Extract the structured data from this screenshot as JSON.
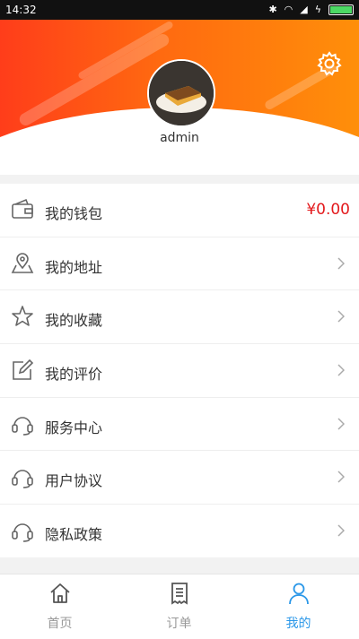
{
  "status_bar": {
    "time": "14:32"
  },
  "profile": {
    "username": "admin"
  },
  "menu": {
    "items": [
      {
        "label": "我的钱包",
        "value": "¥0.00",
        "icon": "wallet-icon"
      },
      {
        "label": "我的地址",
        "icon": "location-icon"
      },
      {
        "label": "我的收藏",
        "icon": "star-icon"
      },
      {
        "label": "我的评价",
        "icon": "edit-icon"
      },
      {
        "label": "服务中心",
        "icon": "headset-icon"
      },
      {
        "label": "用户协议",
        "icon": "headset-icon"
      },
      {
        "label": "隐私政策",
        "icon": "headset-icon"
      }
    ]
  },
  "tabs": [
    {
      "label": "首页",
      "icon": "home-icon",
      "active": false
    },
    {
      "label": "订单",
      "icon": "orders-icon",
      "active": false
    },
    {
      "label": "我的",
      "icon": "user-icon",
      "active": true
    }
  ],
  "colors": {
    "accent": "#2a97e8",
    "header_start": "#ff3d1a",
    "header_end": "#ff8f0a",
    "price": "#e3191c"
  }
}
